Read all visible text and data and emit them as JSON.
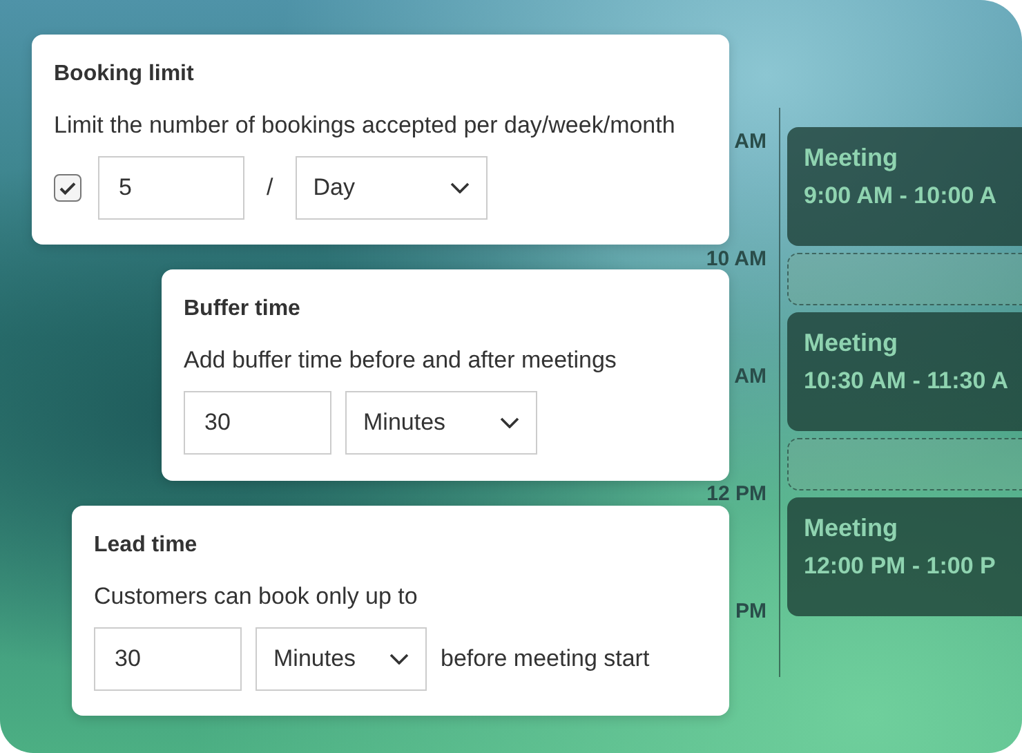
{
  "booking_limit": {
    "title": "Booking limit",
    "description": "Limit the number of bookings accepted per day/week/month",
    "enabled": true,
    "count": "5",
    "separator": "/",
    "period": "Day"
  },
  "buffer_time": {
    "title": "Buffer time",
    "description": "Add buffer time before and after meetings",
    "amount": "30",
    "unit": "Minutes"
  },
  "lead_time": {
    "title": "Lead time",
    "description": "Customers can book only up to",
    "amount": "30",
    "unit": "Minutes",
    "suffix": "before meeting start"
  },
  "calendar": {
    "time_labels": [
      "AM",
      "10 AM",
      "AM",
      "12 PM",
      "PM"
    ],
    "events": [
      {
        "kind": "meeting",
        "title": "Meeting",
        "time": "9:00 AM - 10:00 A"
      },
      {
        "kind": "buffer"
      },
      {
        "kind": "meeting",
        "title": "Meeting",
        "time": "10:30 AM - 11:30 A"
      },
      {
        "kind": "buffer"
      },
      {
        "kind": "meeting",
        "title": "Meeting",
        "time": "12:00 PM - 1:00 P"
      }
    ]
  }
}
